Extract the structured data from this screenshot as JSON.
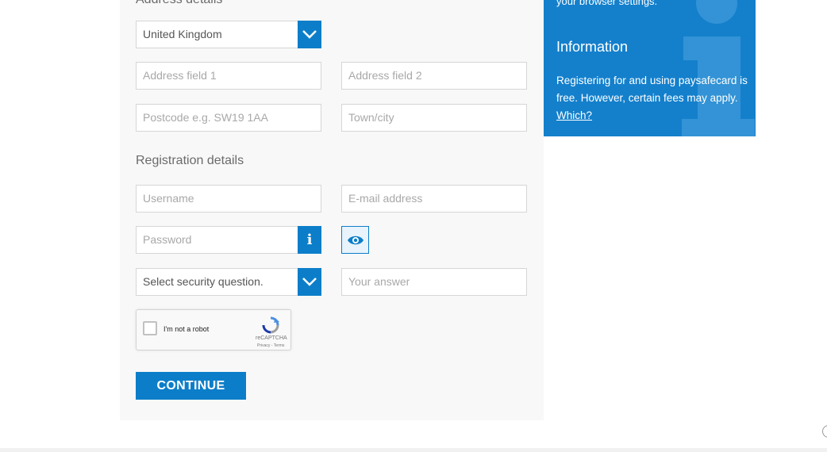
{
  "address_section": {
    "title": "Address details",
    "country": {
      "value": "United Kingdom"
    },
    "address1": {
      "placeholder": "Address field 1"
    },
    "address2": {
      "placeholder": "Address field 2"
    },
    "postcode": {
      "placeholder": "Postcode e.g. SW19 1AA"
    },
    "town": {
      "placeholder": "Town/city"
    }
  },
  "registration_section": {
    "title": "Registration details",
    "username": {
      "placeholder": "Username"
    },
    "email": {
      "placeholder": "E-mail address"
    },
    "password": {
      "placeholder": "Password"
    },
    "security_question": {
      "value": "Select security question."
    },
    "answer": {
      "placeholder": "Your answer"
    }
  },
  "captcha": {
    "label": "I'm not a robot",
    "brand": "reCAPTCHA",
    "links": "Privacy - Terms"
  },
  "continue_label": "CONTINUE",
  "info_card": {
    "clipped_text": "your browser settings.",
    "title": "Information",
    "body": "Registering for and using paysafecard is free. However, certain fees may apply.",
    "link": "Which?"
  },
  "colors": {
    "accent": "#0c7ec9",
    "info_card_bg": "#1480cc",
    "panel_bg": "#f8f8f8"
  },
  "icons": {
    "dropdown": "chevron-down-icon",
    "info": "info-icon",
    "toggle_password": "eye-icon",
    "captcha": "recaptcha-logo-icon"
  }
}
